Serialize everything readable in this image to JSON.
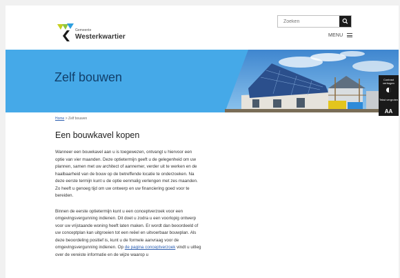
{
  "header": {
    "logo_small": "Gemeente",
    "logo_big": "Westerkwartier",
    "search_placeholder": "Zoeken",
    "menu_label": "MENU"
  },
  "hero": {
    "title": "Zelf bouwen"
  },
  "accessibility": {
    "contrast_label": "Contrast verhogen",
    "text_label": "Tekst vergroten",
    "text_icon": "AA"
  },
  "breadcrumb": {
    "home": "Home",
    "separator": ">",
    "current": "Zelf bouwen"
  },
  "article": {
    "title": "Een bouwkavel kopen",
    "paragraph1": "Wanneer een bouwkavel aan u is toegewezen, ontvangt u hiervoor een optie van vier maanden. Deze optietermijn geeft u de gelegenheid om uw plannen, samen met uw architect of aannemer, verder uit te werken en de haalbaarheid van de bouw op de betreffende locatie te onderzoeken. Na deze eerste termijn kunt u de optie eenmalig verlengen met zes maanden. Zo heeft u genoeg tijd om uw ontwerp en uw financiering goed voor te bereiden.",
    "paragraph2": "Binnen de eerste optietermijn kunt u een conceptverzoek voor een omgevingsvergunning indienen. Dit doet u zodra u een voorlopig ontwerp voor uw vrijstaande woning heeft laten maken. Er wordt dan beoordeeld of uw conceptplan kan uitgroeien tot een reëel en uitvoerbaar bouwplan. Als deze beoordeling positief is, kunt u de formele aanvraag voor de omgevingsvergunning indienen. Op",
    "link_text": "de pagina conceptverzoek",
    "paragraph2_end": "vindt u uitleg over de vereiste informatie en de wijze waarop u"
  },
  "colors": {
    "hero_blue": "#45a9e8",
    "logo_yellow": "#c6cf1e",
    "logo_blue": "#2e9fe0",
    "dark": "#1a1a1a"
  },
  "icons": [
    "search-icon",
    "hamburger-icon",
    "contrast-icon",
    "text-size-icon"
  ]
}
